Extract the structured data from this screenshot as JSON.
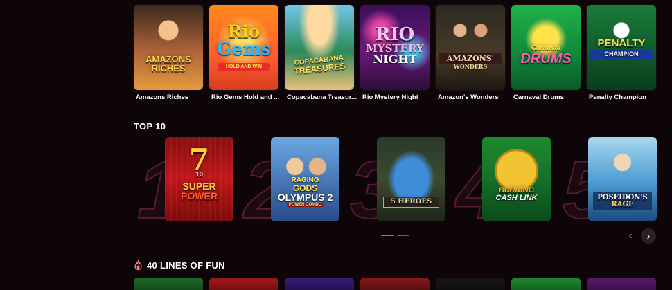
{
  "colors": {
    "background": "#0d0508",
    "accent": "#e0567a",
    "dot_inactive": "#6a6066"
  },
  "games_row": [
    {
      "name": "Amazons Riches",
      "logo_line1": "AMAZONS",
      "logo_line2": "RICHES"
    },
    {
      "name": "Rio Gems Hold and ...",
      "logo_line1": "Rio",
      "logo_line2": "Gems",
      "logo_line3": "HOLD AND WIN"
    },
    {
      "name": "Copacabana Treasur...",
      "logo_line1": "COPACABANA",
      "logo_line2": "TREASURES"
    },
    {
      "name": "Rio Mystery Night",
      "logo_line1": "RIO",
      "logo_line2": "MYSTERY",
      "logo_line3": "NIGHT"
    },
    {
      "name": "Amazon's Wonders",
      "logo_line1": "AMAZONS'",
      "logo_line2": "WONDERS"
    },
    {
      "name": "Carnaval Drums",
      "logo_line1": "Carnaval",
      "logo_line2": "DRUMS"
    },
    {
      "name": "Penalty Champion",
      "logo_line1": "PENALTY",
      "logo_line2": "CHAMPION"
    }
  ],
  "top10": {
    "title": "TOP 10",
    "items": [
      {
        "rank": "1",
        "logo_line1": "7",
        "logo_line2": "10",
        "logo_line3": "SUPER",
        "logo_line4": "POWER"
      },
      {
        "rank": "2",
        "logo_line1": "RAGING",
        "logo_line2": "GODS",
        "logo_line3": "OLYMPUS 2",
        "logo_line4": "POWER COMBO"
      },
      {
        "rank": "3",
        "logo_line1": "5 HEROES"
      },
      {
        "rank": "4",
        "logo_line1": "BURNING",
        "logo_line2": "CASH LINK"
      },
      {
        "rank": "5",
        "logo_line1": "POSEIDON'S",
        "logo_line2": "RAGE"
      }
    ],
    "pagination": {
      "pages": 2,
      "active": 1
    },
    "prev_icon": "chevron-left-icon",
    "next_icon": "chevron-right-icon",
    "prev_glyph": "‹",
    "next_glyph": "›"
  },
  "lines_section": {
    "title": "40 LINES OF FUN",
    "icon": "fire-icon"
  }
}
